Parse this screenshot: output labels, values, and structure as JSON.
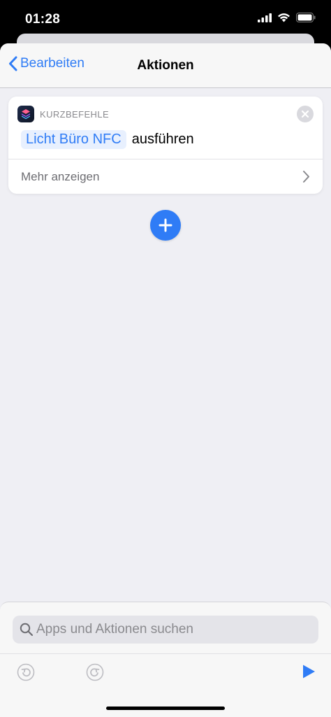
{
  "status_bar": {
    "time": "01:28",
    "icons": [
      "cellular-signal-icon",
      "wifi-icon",
      "battery-icon"
    ]
  },
  "navbar": {
    "back_label": "Bearbeiten",
    "title": "Aktionen"
  },
  "action_card": {
    "app_label": "KURZBEFEHLE",
    "token": "Licht Büro NFC",
    "action_text": "ausführen",
    "more_label": "Mehr anzeigen"
  },
  "search": {
    "placeholder": "Apps und Aktionen suchen",
    "value": ""
  },
  "toolbar": {
    "icons": [
      "undo-icon",
      "redo-icon",
      "play-icon"
    ]
  },
  "colors": {
    "accent": "#2f7cf6",
    "background": "#efeff4",
    "card": "#ffffff"
  }
}
